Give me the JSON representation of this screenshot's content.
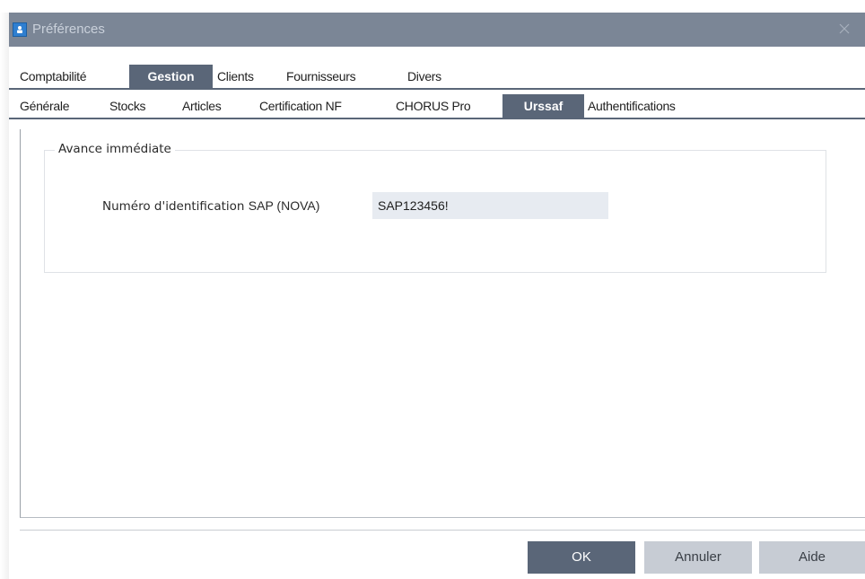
{
  "window": {
    "title": "Préférences",
    "close_symbol": "×",
    "titlebar_color": "#7b8696",
    "accent_color": "#5a6678"
  },
  "main_tabs": [
    {
      "label": "Comptabilité",
      "active": false
    },
    {
      "label": "Gestion",
      "active": true
    },
    {
      "label": "Clients",
      "active": false
    },
    {
      "label": "Fournisseurs",
      "active": false
    },
    {
      "label": "Divers",
      "active": false
    }
  ],
  "sub_tabs": [
    {
      "label": "Générale",
      "active": false
    },
    {
      "label": "Stocks",
      "active": false
    },
    {
      "label": "Articles",
      "active": false
    },
    {
      "label": "Certification NF",
      "active": false
    },
    {
      "label": "CHORUS Pro",
      "active": false
    },
    {
      "label": "Urssaf",
      "active": true
    },
    {
      "label": "Authentifications",
      "active": false
    }
  ],
  "group": {
    "legend": "Avance immédiate",
    "sap_label_start": "Numéro d'identification",
    "sap_label_end": "SAP (NOVA)",
    "sap_value": "SAP123456!",
    "input_bg": "#e7ebf1"
  },
  "buttons": {
    "ok": "OK",
    "cancel": "Annuler",
    "help": "Aide"
  }
}
